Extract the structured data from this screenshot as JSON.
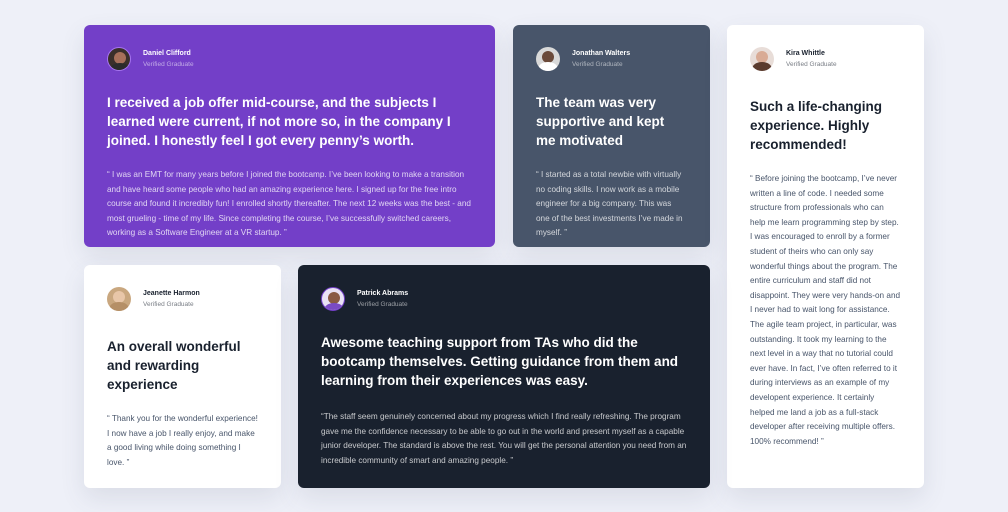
{
  "testimonials": [
    {
      "name": "Daniel Clifford",
      "status": "Verified Graduate",
      "headline": "I received a job offer mid-course, and the subjects I learned were current, if not more so, in the company I joined. I honestly feel I got every penny’s worth.",
      "quote": "“ I was an EMT for many years before I joined the bootcamp. I’ve been looking to make a transition and have heard some people who had an amazing experience here. I signed up for the free intro course and found it incredibly fun! I enrolled shortly thereafter. The next 12 weeks was the best - and most grueling - time of my life. Since completing the course, I’ve successfully switched careers, working as a Software Engineer at a VR startup. ”"
    },
    {
      "name": "Jonathan Walters",
      "status": "Verified Graduate",
      "headline": "The team was very supportive and kept me motivated",
      "quote": "“ I started as a total newbie with virtually no coding skills. I now work as a mobile engineer for a big company. This was one of the best investments I’ve made in myself. ”"
    },
    {
      "name": "Kira Whittle",
      "status": "Verified Graduate",
      "headline": "Such a life-changing experience. Highly recommended!",
      "quote": "“ Before joining the bootcamp, I’ve never written a line of code. I needed some structure from professionals who can help me learn programming step by step. I was encouraged to enroll by a former student of theirs who can only say wonderful things about the program. The entire curriculum and staff did not disappoint. They were very hands-on and I never had to wait long for assistance. The agile team project, in particular, was outstanding. It took my learning to the next level in a way that no tutorial could ever have. In fact, I’ve often referred to it during interviews as an example of my developent experience. It certainly helped me land a job as a full-stack developer after receiving multiple offers. 100% recommend! ”"
    },
    {
      "name": "Jeanette Harmon",
      "status": "Verified Graduate",
      "headline": "An overall wonderful and rewarding experience",
      "quote": "“ Thank you for the wonderful experience! I now have a job I really enjoy, and make a good living while doing something I love. ”"
    },
    {
      "name": "Patrick Abrams",
      "status": "Verified Graduate",
      "headline": "Awesome teaching support from TAs who did the bootcamp themselves. Getting guidance from them and learning from their experiences was easy.",
      "quote": "“The staff seem genuinely concerned about my progress which I find really refreshing. The program gave me the confidence necessary to be able to go out in the world and present myself as a capable junior developer. The standard is above the rest. You will get the personal attention you need from an incredible community of smart and amazing people. ”"
    }
  ],
  "colors": {
    "background": "#eef0f8",
    "purple": "#733fc8",
    "gray_blue": "#48556a",
    "dark": "#19212e",
    "white": "#ffffff"
  }
}
